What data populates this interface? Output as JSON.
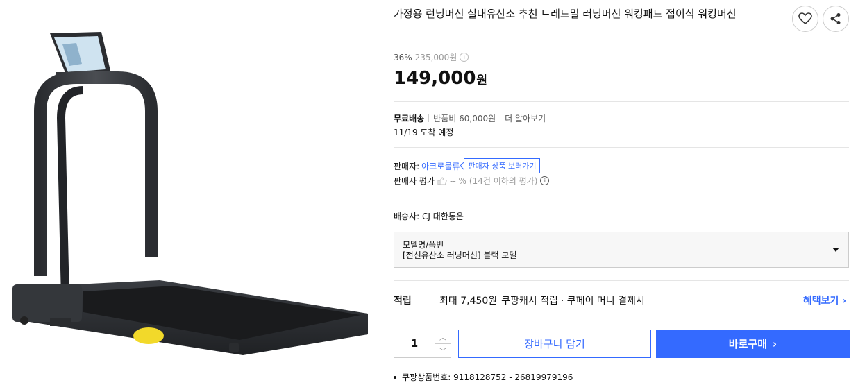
{
  "product": {
    "title": "가정용 런닝머신 실내유산소 추천 트레드밀 러닝머신 워킹패드 접이식 워킹머신",
    "discount_rate": "36%",
    "original_price": "235,000원",
    "price": "149,000",
    "price_unit": "원"
  },
  "shipping": {
    "free": "무료배송",
    "return_fee": "반품비 60,000원",
    "more": "더 알아보기",
    "arrival": "11/19 도착 예정"
  },
  "seller": {
    "label": "판매자:",
    "name": "아크로물류",
    "link": "판매자 상품 보러가기",
    "rating_label": "판매자 평가",
    "rating_value": "-- %",
    "rating_note": "(14건 이하의 평가)"
  },
  "carrier": {
    "label": "배송사:",
    "name": "CJ 대한통운"
  },
  "option": {
    "label": "모델명/품번",
    "value": "[전신유산소 러닝머신] 블랙 모델"
  },
  "reward": {
    "heading": "적립",
    "max": "최대 7,450원",
    "cash": "쿠팡캐시 적립",
    "note": "· 쿠페이 머니 결제시",
    "more": "혜택보기"
  },
  "purchase": {
    "quantity": "1",
    "cart_label": "장바구니 담기",
    "buy_label": "바로구매"
  },
  "product_code": "쿠팡상품번호: 9118128752 - 26819979196",
  "colors": {
    "accent": "#346aff"
  }
}
